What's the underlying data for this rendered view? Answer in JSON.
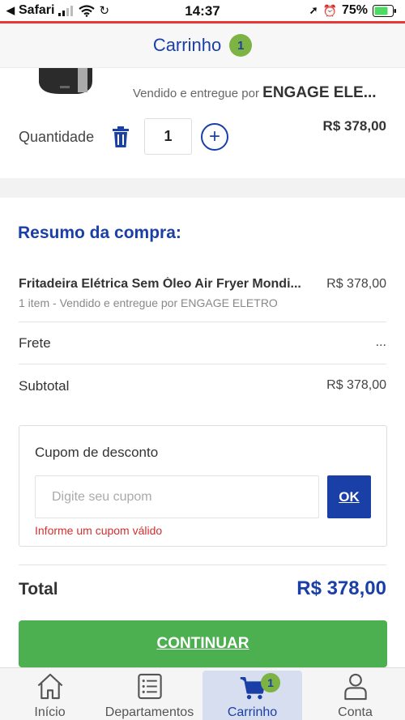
{
  "status_bar": {
    "carrier": "Safari",
    "time": "14:37",
    "battery": "75%"
  },
  "header": {
    "title": "Carrinho",
    "cart_count": "1"
  },
  "product": {
    "sold_by_prefix": "Vendido e entregue por",
    "seller": "ENGAGE ELE...",
    "quantity_label": "Quantidade",
    "quantity": "1",
    "price": "R$ 378,00"
  },
  "summary": {
    "title": "Resumo da compra:",
    "item_name": "Fritadeira Elétrica Sem Óleo Air Fryer Mondi...",
    "item_price": "R$ 378,00",
    "item_sub": "1 item - Vendido e entregue por ENGAGE ELETRO",
    "frete_label": "Frete",
    "frete_value": "...",
    "subtotal_label": "Subtotal",
    "subtotal_value": "R$ 378,00"
  },
  "coupon": {
    "label": "Cupom de desconto",
    "placeholder": "Digite seu cupom",
    "button": "OK",
    "error": "Informe um cupom válido"
  },
  "total": {
    "label": "Total",
    "value": "R$ 378,00"
  },
  "continue_button": "CONTINUAR",
  "nav": {
    "items": [
      {
        "label": "Início",
        "icon": "home-icon"
      },
      {
        "label": "Departamentos",
        "icon": "list-icon"
      },
      {
        "label": "Carrinho",
        "icon": "cart-icon",
        "badge": "1",
        "active": true
      },
      {
        "label": "Conta",
        "icon": "user-icon"
      }
    ]
  },
  "colors": {
    "brand_blue": "#1a3fa6",
    "badge_green": "#7cb342",
    "continue_green": "#4caf50",
    "error_red": "#d32f2f"
  }
}
